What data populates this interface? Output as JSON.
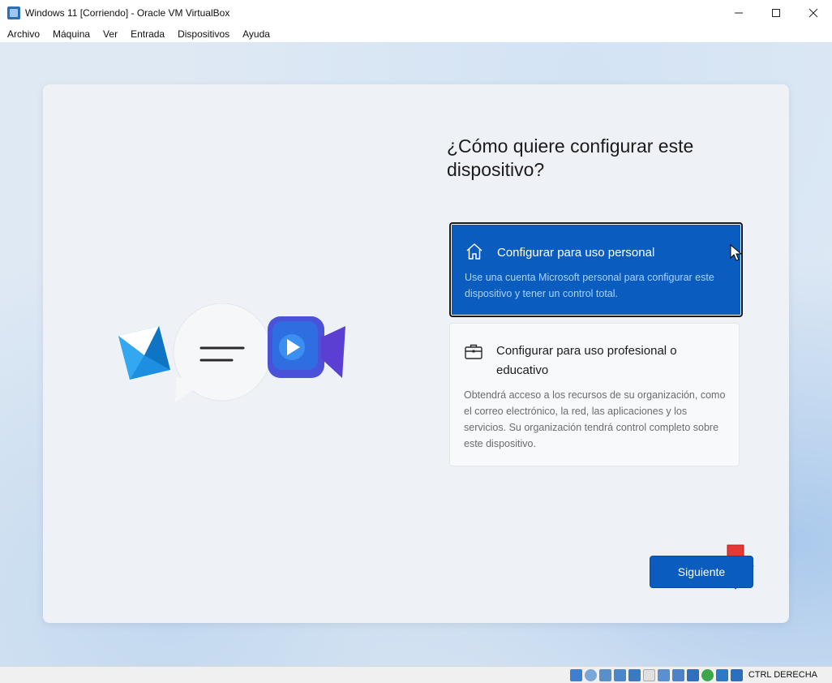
{
  "window": {
    "title": "Windows 11 [Corriendo] - Oracle VM VirtualBox",
    "controls": {
      "minimize": "—",
      "maximize": "☐",
      "close": "✕"
    }
  },
  "menubar": {
    "items": [
      {
        "label": "Archivo"
      },
      {
        "label": "Máquina"
      },
      {
        "label": "Ver"
      },
      {
        "label": "Entrada"
      },
      {
        "label": "Dispositivos"
      },
      {
        "label": "Ayuda"
      }
    ]
  },
  "oobe": {
    "heading": "¿Cómo quiere configurar este dispositivo?",
    "options": [
      {
        "icon": "home-icon",
        "title": "Configurar para uso personal",
        "description": "Use una cuenta Microsoft personal para configurar este dispositivo y tener un control total.",
        "selected": true
      },
      {
        "icon": "briefcase-icon",
        "title": "Configurar para uso profesional o educativo",
        "description": "Obtendrá acceso a los recursos de su organización, como el correo electrónico, la red, las aplicaciones y los servicios. Su organización tendrá control completo sobre este dispositivo.",
        "selected": false
      }
    ],
    "next_label": "Siguiente"
  },
  "tray": {
    "icons": [
      "accessibility-icon",
      "volume-icon"
    ]
  },
  "statusbar": {
    "icons": [
      "hard-disk-icon",
      "optical-drive-icon",
      "audio-icon",
      "network-icon",
      "usb-icon",
      "shared-folders-icon",
      "display-icon",
      "recording-icon",
      "cpu-icon",
      "guest-additions-icon",
      "mouse-integration-icon",
      "keyboard-icon"
    ],
    "host_key": "CTRL DERECHA"
  },
  "colors": {
    "accent": "#0a5cbe",
    "selected_desc": "#aad4ff",
    "card_bg": "#eef2f7",
    "annotation_arrow": "#e53935"
  }
}
